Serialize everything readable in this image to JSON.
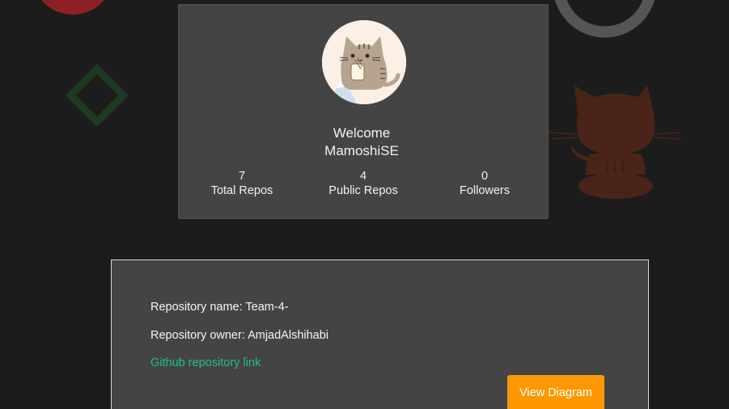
{
  "profile": {
    "welcome_line1": "Welcome",
    "welcome_line2": "MamoshiSE",
    "stats": [
      {
        "value": "7",
        "label": "Total Repos"
      },
      {
        "value": "4",
        "label": "Public Repos"
      },
      {
        "value": "0",
        "label": "Followers"
      }
    ]
  },
  "repository": {
    "name_line": "Repository name: Team-4-",
    "owner_line": "Repository owner: AmjadAlshihabi",
    "link_label": "Github repository link",
    "button_label": "View Diagram"
  },
  "colors": {
    "background": "#1c1c1c",
    "card": "#444444",
    "link": "#1fbf8f",
    "button": "#ff9800",
    "deco_red": "#8e2024",
    "deco_green": "#1e3a22",
    "deco_ring": "#555555",
    "deco_octocat": "#4a2418"
  },
  "icons": {
    "avatar": "pusheen-cat-avatar",
    "octocat": "github-octocat-icon"
  }
}
